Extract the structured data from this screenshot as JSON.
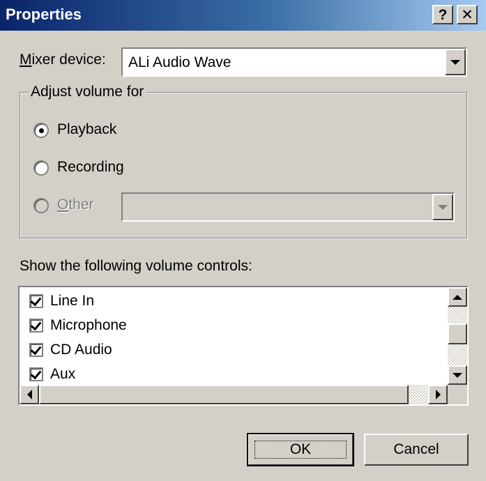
{
  "window": {
    "title": "Properties",
    "help_button": "?",
    "close_button": "✕"
  },
  "mixer": {
    "label_underlined": "M",
    "label_rest": "ixer device:",
    "value": "ALi Audio Wave"
  },
  "adjust_group": {
    "legend": "Adjust volume for",
    "options": [
      {
        "label": "Playback",
        "selected": true,
        "enabled": true
      },
      {
        "label": "Recording",
        "selected": false,
        "enabled": true
      },
      {
        "label_underlined": "O",
        "label_rest": "ther",
        "selected": false,
        "enabled": false
      }
    ]
  },
  "controls_list": {
    "label": "Show the following volume controls:",
    "items": [
      {
        "label": "Line In",
        "checked": true
      },
      {
        "label": "Microphone",
        "checked": true
      },
      {
        "label": "CD Audio",
        "checked": true
      },
      {
        "label": "Aux",
        "checked": true
      }
    ]
  },
  "buttons": {
    "ok": "OK",
    "cancel": "Cancel"
  },
  "colors": {
    "titlebar_start": "#0a246a",
    "titlebar_end": "#a6caf0",
    "face": "#d4d0c8"
  }
}
